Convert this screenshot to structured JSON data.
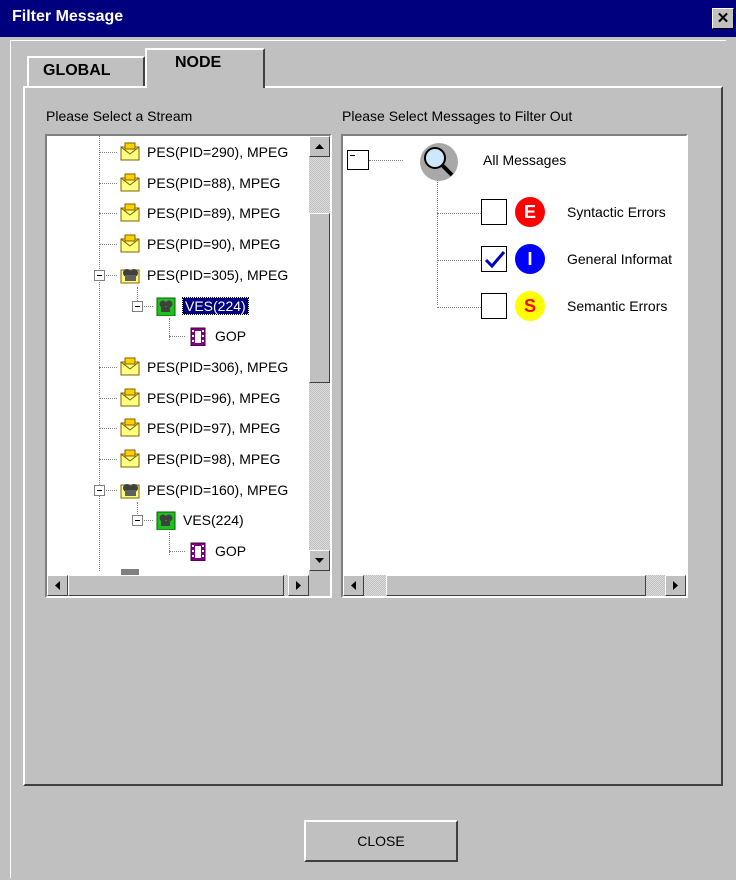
{
  "window": {
    "title": "Filter Message",
    "close_glyph": "✕"
  },
  "tabs": [
    {
      "label": "GLOBAL",
      "active": false
    },
    {
      "label": "NODE",
      "active": true
    }
  ],
  "stream_panel": {
    "label": "Please Select a Stream",
    "items": [
      {
        "text": "PES(PID=290), MPEG",
        "icon": "envelope-icon",
        "level": 1
      },
      {
        "text": "PES(PID=88), MPEG",
        "icon": "envelope-icon",
        "level": 1
      },
      {
        "text": "PES(PID=89), MPEG",
        "icon": "envelope-icon",
        "level": 1
      },
      {
        "text": "PES(PID=90), MPEG",
        "icon": "envelope-icon",
        "level": 1
      },
      {
        "text": "PES(PID=305), MPEG",
        "icon": "camera-envelope-icon",
        "level": 1,
        "expanded": true
      },
      {
        "text": "VES(224)",
        "icon": "video-icon",
        "level": 2,
        "expanded": true,
        "selected": true
      },
      {
        "text": "GOP",
        "icon": "film-icon",
        "level": 3
      },
      {
        "text": "PES(PID=306), MPEG",
        "icon": "envelope-icon",
        "level": 1
      },
      {
        "text": "PES(PID=96), MPEG",
        "icon": "envelope-icon",
        "level": 1
      },
      {
        "text": "PES(PID=97), MPEG",
        "icon": "envelope-icon",
        "level": 1
      },
      {
        "text": "PES(PID=98), MPEG",
        "icon": "envelope-icon",
        "level": 1
      },
      {
        "text": "PES(PID=160), MPEG",
        "icon": "camera-envelope-icon",
        "level": 1,
        "expanded": true
      },
      {
        "text": "VES(224)",
        "icon": "video-icon",
        "level": 2,
        "expanded": true
      },
      {
        "text": "GOP",
        "icon": "film-icon",
        "level": 3
      }
    ]
  },
  "message_panel": {
    "label": "Please Select Messages to Filter Out",
    "root": {
      "text": "All Messages",
      "icon": "magnifier-icon"
    },
    "items": [
      {
        "text": "Syntactic Errors",
        "badge": "E",
        "badge_color": "#ff0000",
        "badge_text_color": "#ffffff",
        "checked": false
      },
      {
        "text": "General Informat",
        "badge": "I",
        "badge_color": "#0000ff",
        "badge_text_color": "#ffffff",
        "checked": true
      },
      {
        "text": "Semantic Errors",
        "badge": "S",
        "badge_color": "#ffff00",
        "badge_text_color": "#ff0000",
        "checked": false
      }
    ]
  },
  "buttons": {
    "close": "CLOSE"
  }
}
